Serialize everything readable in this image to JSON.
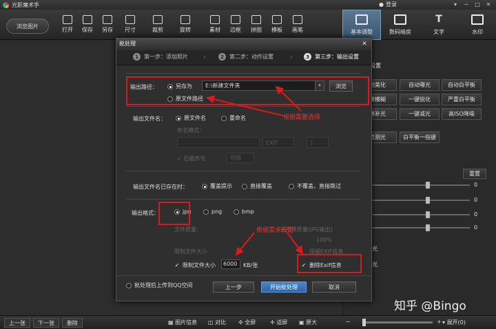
{
  "app": {
    "title": "光影魔术手",
    "login": "登录"
  },
  "toolbar": {
    "browse": "浏览图片",
    "items": [
      "打开",
      "保存",
      "另存",
      "尺寸",
      "裁剪",
      "旋转",
      "素材",
      "边框",
      "拼图",
      "模板",
      "画笔"
    ],
    "tabs": [
      "基本调整",
      "数码暗房",
      "文字",
      "水印"
    ]
  },
  "right_panel": {
    "header_fragment": "设置",
    "buttons": [
      "动美化",
      "自动曝光",
      "自动白平衡",
      "建模糊",
      "一键锐化",
      "严重白平衡",
      "建补光",
      "一键减光",
      "高ISO降噪",
      "点测光",
      "白平衡一指键"
    ],
    "reset": "重置",
    "slider_values": [
      "0",
      "0",
      "0",
      "0"
    ],
    "fragment_1": "光",
    "fragment_2": "光"
  },
  "dialog": {
    "title": "批处理",
    "steps": [
      {
        "num": "1",
        "label": "第一步：添加照片"
      },
      {
        "num": "2",
        "label": "第二步：动作设置"
      },
      {
        "num": "3",
        "label": "第三步：输出设置"
      }
    ],
    "output_path_label": "输出路径：",
    "save_as": "另存为",
    "path_value": "E:\\新建文件夹",
    "browse_btn": "浏览",
    "original_path": "原文件路径",
    "filename_label": "输出文件名：",
    "original_name": "原文件名",
    "rename": "重命名",
    "naming_format": "命名模式：",
    "exif": "EXIF",
    "seq_num": "1",
    "add_seq": "后缀序号",
    "detail": "明细",
    "exists_label": "输出文件名已存在时：",
    "overwrite_prompt": "覆盖提示",
    "overwrite_direct": "直接覆盖",
    "skip": "不覆盖，直接跳过",
    "format_label": "输出格式：",
    "fmt_jpg": "jpg",
    "fmt_png": "png",
    "fmt_bmp": "bmp",
    "file_quality": "文件质量：",
    "quality_hint": "采用原质量(JPG输出)",
    "quality_value": "100%",
    "limit_hint": "限制文件大小",
    "limit_size": "限制文件大小",
    "size_value": "6000",
    "size_unit": "KB/张",
    "keep_exif_hint": "保留EXIF信息",
    "remove_exif": "删除Exif信息",
    "upload_qq": "批处理后上传到QQ空间",
    "prev_btn": "上一步",
    "start_btn": "开始批处理",
    "cancel_btn": "取消",
    "annotation_1": "根据需要选择",
    "annotation_2": "根据需求设定"
  },
  "bottom": {
    "prev": "上一张",
    "next": "下一张",
    "delete": "删除",
    "info": "图片信息",
    "compare": "对比",
    "fullscreen": "全屏",
    "fit": "适屏",
    "original": "原大",
    "expand": "展开(0)"
  },
  "watermark": "知乎 @Bingo",
  "colors": {
    "accent_red": "#e01818",
    "primary_blue": "#3a78c0"
  }
}
